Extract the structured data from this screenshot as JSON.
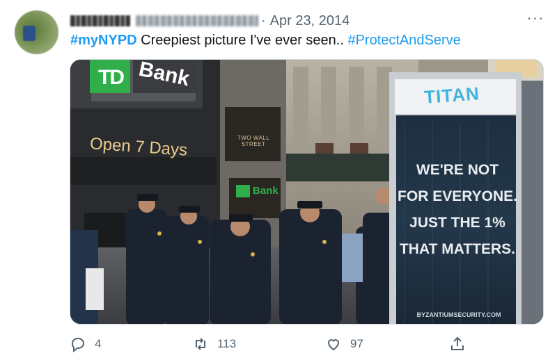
{
  "tweet": {
    "date": "Apr 23, 2014",
    "separator": "·",
    "more_label": "···",
    "text_hashtag1": "#myNYPD",
    "text_body": " Creepiest picture I've ever seen.. ",
    "text_hashtag2": "#ProtectAndServe"
  },
  "photo": {
    "bank_sign": "Bank",
    "bank_logo": "TD",
    "open_sign": "Open 7 Days",
    "building_sign": "TWO WALL STREET",
    "small_bank_sign": "Bank",
    "kiosk_brand": "TITAN",
    "ad_line1": "WE'RE NOT",
    "ad_line2": "FOR EVERYONE.",
    "ad_line3": "JUST THE 1%",
    "ad_line4": "THAT MATTERS.",
    "ad_footer": "BYZANTIUMSECURITY.COM"
  },
  "actions": {
    "replies": "4",
    "retweets": "113",
    "likes": "97"
  },
  "colors": {
    "link": "#1d9bf0",
    "muted": "#536471",
    "td_green": "#2fae4a"
  }
}
